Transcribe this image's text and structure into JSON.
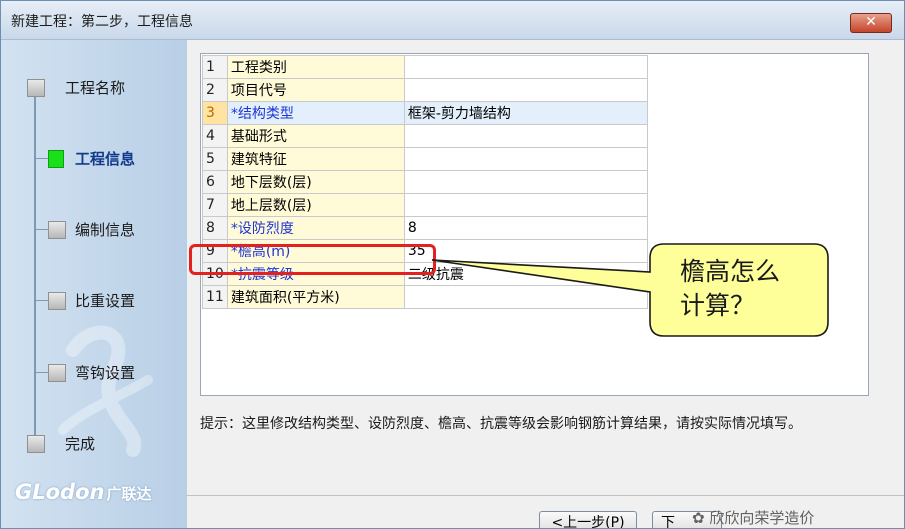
{
  "window": {
    "title": "新建工程：第二步，工程信息",
    "close_glyph": "✕"
  },
  "sidebar": {
    "steps": [
      {
        "label": "工程名称",
        "state": "done"
      },
      {
        "label": "工程信息",
        "state": "active"
      },
      {
        "label": "编制信息",
        "state": "pending"
      },
      {
        "label": "比重设置",
        "state": "pending"
      },
      {
        "label": "弯钩设置",
        "state": "pending"
      },
      {
        "label": "完成",
        "state": "pending"
      }
    ],
    "logo_latin": "GLodon",
    "logo_cn": "广联达"
  },
  "grid": {
    "rows": [
      {
        "num": "1",
        "name": "工程类别",
        "value": "",
        "required": false
      },
      {
        "num": "2",
        "name": "项目代号",
        "value": "",
        "required": false
      },
      {
        "num": "3",
        "name": "*结构类型",
        "value": "框架-剪力墙结构",
        "required": true
      },
      {
        "num": "4",
        "name": "基础形式",
        "value": "",
        "required": false
      },
      {
        "num": "5",
        "name": "建筑特征",
        "value": "",
        "required": false
      },
      {
        "num": "6",
        "name": "地下层数(层)",
        "value": "",
        "required": false
      },
      {
        "num": "7",
        "name": "地上层数(层)",
        "value": "",
        "required": false
      },
      {
        "num": "8",
        "name": "*设防烈度",
        "value": "8",
        "required": true
      },
      {
        "num": "9",
        "name": "*檐高(m)",
        "value": "35",
        "required": true
      },
      {
        "num": "10",
        "name": "*抗震等级",
        "value": "二级抗震",
        "required": true
      },
      {
        "num": "11",
        "name": "建筑面积(平方米)",
        "value": "",
        "required": false
      }
    ],
    "selected_row": "3"
  },
  "hint": "提示：这里修改结构类型、设防烈度、檐高、抗震等级会影响钢筋计算结果，请按实际情况填写。",
  "buttons": {
    "prev": "<上一步(P)",
    "next": "下"
  },
  "annotation": {
    "callout_line1": "檐高怎么",
    "callout_line2": "计算？",
    "highlight_color": "#e32121",
    "bubble_color": "#ffff99"
  },
  "watermark": "欣欣向荣学造价"
}
